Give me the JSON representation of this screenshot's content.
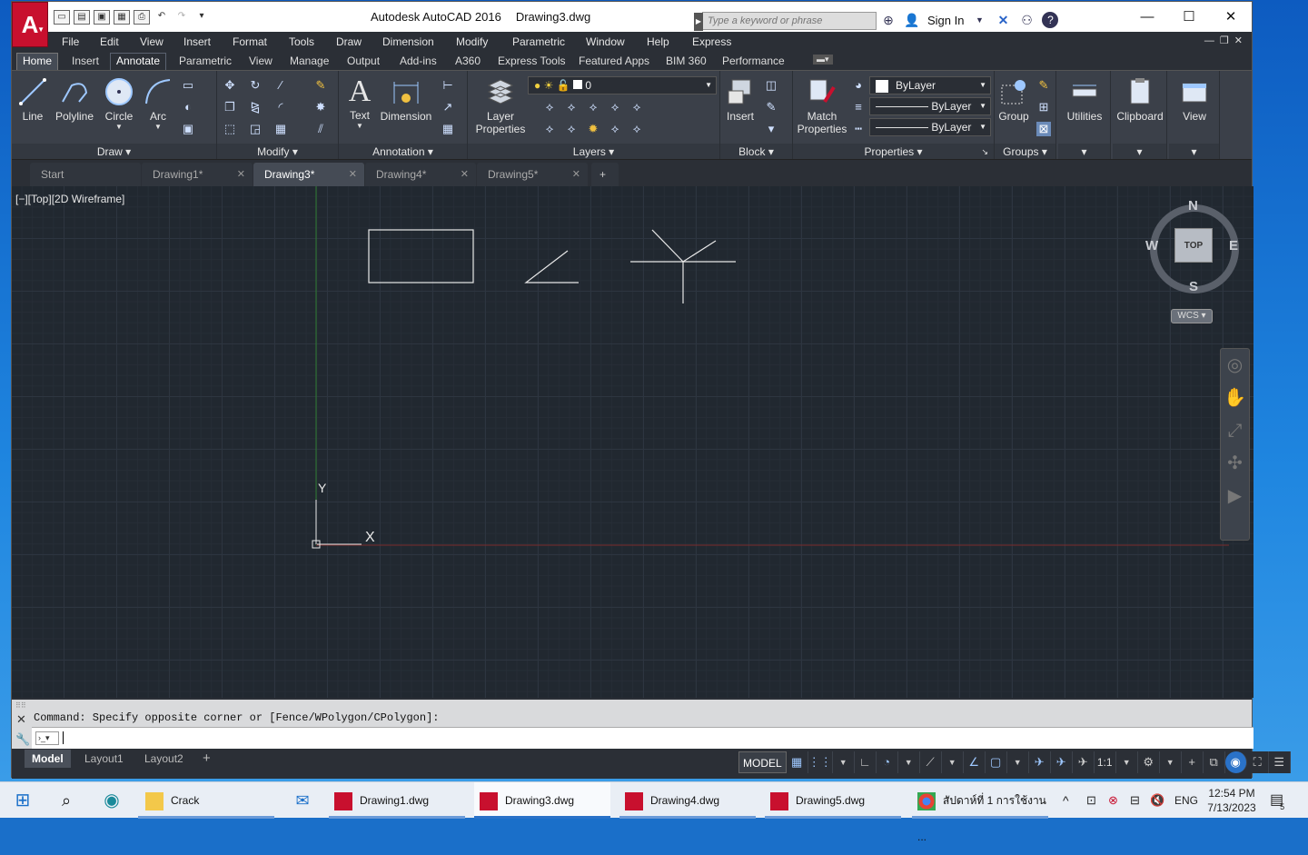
{
  "app": {
    "title": "Autodesk AutoCAD 2016",
    "document": "Drawing3.dwg",
    "logo_letter": "A"
  },
  "search": {
    "placeholder": "Type a keyword or phrase"
  },
  "account": {
    "sign_in": "Sign In"
  },
  "menu": [
    "File",
    "Edit",
    "View",
    "Insert",
    "Format",
    "Tools",
    "Draw",
    "Dimension",
    "Modify",
    "Parametric",
    "Window",
    "Help",
    "Express"
  ],
  "ribbon_tabs": [
    "Home",
    "Insert",
    "Annotate",
    "Parametric",
    "View",
    "Manage",
    "Output",
    "Add-ins",
    "A360",
    "Express Tools",
    "Featured Apps",
    "BIM 360",
    "Performance"
  ],
  "ribbon": {
    "draw": {
      "label": "Draw",
      "line": "Line",
      "polyline": "Polyline",
      "circle": "Circle",
      "arc": "Arc"
    },
    "modify": {
      "label": "Modify"
    },
    "annotation": {
      "label": "Annotation",
      "text": "Text",
      "dimension": "Dimension"
    },
    "layers": {
      "label": "Layers",
      "layer_properties_1": "Layer",
      "layer_properties_2": "Properties",
      "current_layer": "0"
    },
    "block": {
      "label": "Block",
      "insert": "Insert"
    },
    "properties": {
      "label": "Properties",
      "match_1": "Match",
      "match_2": "Properties",
      "color": "ByLayer",
      "linetype": "ByLayer",
      "lineweight": "ByLayer"
    },
    "groups": {
      "label": "Groups",
      "group": "Group"
    },
    "utilities": {
      "label": "Utilities"
    },
    "clipboard": {
      "label": "Clipboard"
    },
    "view": {
      "label": "View"
    }
  },
  "doc_tabs": [
    {
      "label": "Start"
    },
    {
      "label": "Drawing1*"
    },
    {
      "label": "Drawing3*"
    },
    {
      "label": "Drawing4*"
    },
    {
      "label": "Drawing5*"
    }
  ],
  "viewport": {
    "label": "[−][Top][2D Wireframe]"
  },
  "viewcube": {
    "n": "N",
    "s": "S",
    "e": "E",
    "w": "W",
    "face": "TOP",
    "wcs": "WCS"
  },
  "ucs": {
    "x": "X",
    "y": "Y"
  },
  "command": {
    "history": "Command: Specify opposite corner or [Fence/WPolygon/CPolygon]:"
  },
  "layout_tabs": [
    "Model",
    "Layout1",
    "Layout2"
  ],
  "status": {
    "model": "MODEL",
    "scale": "1:1"
  },
  "taskbar": {
    "items": [
      {
        "label": "Crack"
      },
      {
        "label": "Drawing1.dwg"
      },
      {
        "label": "Drawing3.dwg"
      },
      {
        "label": "Drawing4.dwg"
      },
      {
        "label": "Drawing5.dwg"
      },
      {
        "label": "สัปดาห์ที่ 1 การใช้งาน ..."
      }
    ],
    "lang": "ENG",
    "time": "12:54 PM",
    "date": "7/13/2023",
    "notifications": "5"
  }
}
